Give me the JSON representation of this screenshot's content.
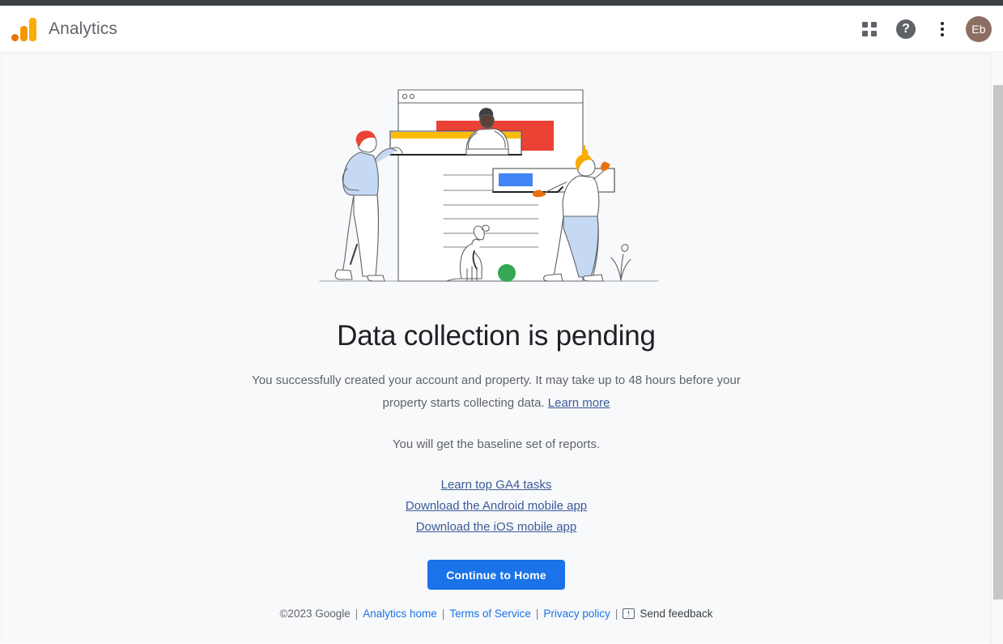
{
  "header": {
    "brand_title": "Analytics",
    "logo_icon": "google-analytics-logo",
    "apps_icon": "apps-grid-icon",
    "help_icon": "help-icon",
    "help_glyph": "?",
    "more_icon": "more-vert-icon",
    "avatar_initials": "Eb"
  },
  "main": {
    "illustration_name": "data-collection-pending-illustration",
    "headline": "Data collection is pending",
    "body_text_1": "You successfully created your account and property. It may take up to 48 hours before your property starts collecting data. ",
    "learn_more_label": "Learn more",
    "baseline_text": "You will get the baseline set of reports.",
    "links": [
      {
        "label": "Learn top GA4 tasks",
        "name": "learn-top-ga4-tasks-link"
      },
      {
        "label": "Download the Android mobile app",
        "name": "download-android-app-link"
      },
      {
        "label": "Download the iOS mobile app",
        "name": "download-ios-app-link"
      }
    ],
    "cta_label": "Continue to Home"
  },
  "footer": {
    "copyright": "©2023 Google",
    "separator": "|",
    "analytics_home_label": "Analytics home",
    "terms_label": "Terms of Service",
    "privacy_label": "Privacy policy",
    "feedback_label": "Send feedback",
    "feedback_icon": "feedback-icon"
  },
  "colors": {
    "accent_blue": "#1a73e8",
    "link_blue": "#3c5a99",
    "logo_orange": "#f9ab00",
    "avatar_brown": "#8d6e63",
    "background": "#f8f9fa",
    "text_primary": "#202124",
    "text_secondary": "#5f6368"
  },
  "scrollbar": {
    "name": "vertical-scrollbar"
  }
}
